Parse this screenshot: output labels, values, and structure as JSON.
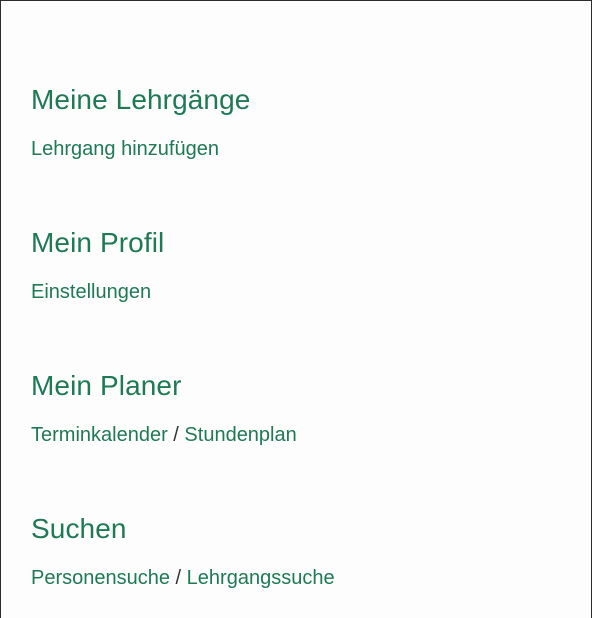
{
  "sections": [
    {
      "heading": "Meine Lehrgänge",
      "links": [
        "Lehrgang hinzufügen"
      ]
    },
    {
      "heading": "Mein Profil",
      "links": [
        "Einstellungen"
      ]
    },
    {
      "heading": "Mein Planer",
      "links": [
        "Terminkalender",
        "Stundenplan"
      ],
      "separator": "/"
    },
    {
      "heading": "Suchen",
      "links": [
        "Personensuche",
        "Lehrgangssuche"
      ],
      "separator": "/"
    }
  ],
  "colors": {
    "accent": "#1e7a55",
    "separator": "#333333",
    "background": "#fdfdfd"
  }
}
